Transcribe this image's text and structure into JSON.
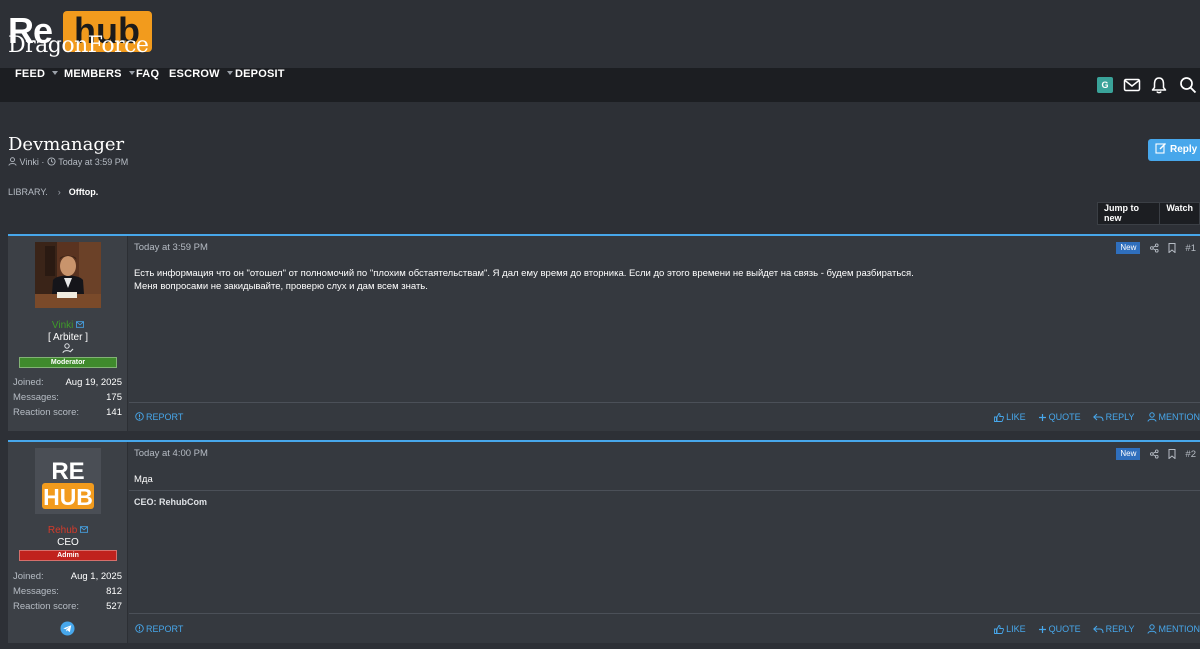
{
  "logo": {
    "re": "Re",
    "hub": "hub",
    "dragon": "Dragon",
    "force": "Force"
  },
  "nav": {
    "items": [
      {
        "label": "FEED",
        "dropdown": true
      },
      {
        "label": "MEMBERS",
        "dropdown": true
      },
      {
        "label": "FAQ",
        "dropdown": false
      },
      {
        "label": "ESCROW",
        "dropdown": true
      },
      {
        "label": "DEPOSIT",
        "dropdown": false
      }
    ],
    "avatar_letter": "G",
    "icons": [
      "envelope-icon",
      "bell-icon",
      "search-icon"
    ]
  },
  "thread": {
    "title": "Devmanager",
    "author": "Vinki",
    "date": "Today at 3:59 PM",
    "reply_label": "Reply"
  },
  "breadcrumb": {
    "parent": "LIBRARY.",
    "current": "Offtop."
  },
  "buttons": {
    "jump": "Jump to new",
    "watch": "Watch"
  },
  "colors": {
    "accent": "#47a7eb",
    "moderator": "#3f8a2c",
    "admin": "#c0221d",
    "new_badge": "#2f6fbd"
  },
  "posts": [
    {
      "author": "Vinki",
      "author_color": "#3f9b2a",
      "user_title": "[ Arbiter ]",
      "banner": "Moderator",
      "joined_label": "Joined:",
      "joined": "Aug 19, 2025",
      "messages_label": "Messages:",
      "messages": "175",
      "reaction_label": "Reaction score:",
      "reaction": "141",
      "date": "Today at 3:59 PM",
      "badge": "New",
      "number": "#1",
      "body_line1": "Есть информация что он \"отошел\" от полномочий по \"плохим обстаятельствам\". Я дал ему время до вторника. Если до этого времени не выйдет на связь - будем разбираться.",
      "body_line2": "Меня вопросами не закидывайте, проверю слух и дам всем знать.",
      "signature": ""
    },
    {
      "author": "Rehub",
      "author_color": "#d43a2a",
      "user_title": "CEO",
      "banner": "Admin",
      "joined_label": "Joined:",
      "joined": "Aug 1, 2025",
      "messages_label": "Messages:",
      "messages": "812",
      "reaction_label": "Reaction score:",
      "reaction": "527",
      "date": "Today at 4:00 PM",
      "badge": "New",
      "number": "#2",
      "body_line1": "Мда",
      "body_line2": "",
      "signature": "CEO: RehubCom",
      "avatar_text_top": "RE",
      "avatar_text_bottom": "HUB"
    }
  ],
  "post_actions": {
    "report": "REPORT",
    "like": "LIKE",
    "quote": "QUOTE",
    "reply": "REPLY",
    "mention": "MENTION"
  }
}
